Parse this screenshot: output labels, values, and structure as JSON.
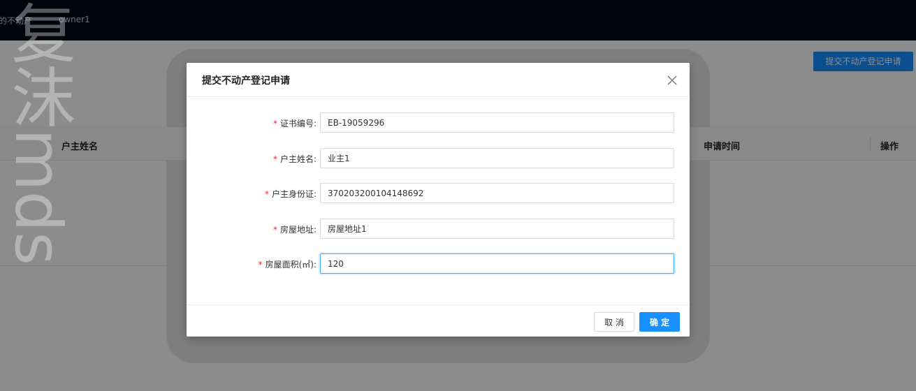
{
  "topbar": {
    "nav_item": "的不动产",
    "user": "owner1"
  },
  "toolbar": {
    "submit_label": "提交不动产登记申请"
  },
  "table": {
    "headers": [
      "户主姓名",
      "申请时间",
      "操作"
    ]
  },
  "watermark": {
    "text": "复沫mds"
  },
  "modal": {
    "title": "提交不动产登记申请",
    "close_icon": "close-icon",
    "fields": [
      {
        "label": "证书编号:",
        "value": "EB-19059296",
        "required": true
      },
      {
        "label": "户主姓名:",
        "value": "业主1",
        "required": true
      },
      {
        "label": "户主身份证:",
        "value": "370203200104148692",
        "required": true
      },
      {
        "label": "房屋地址:",
        "value": "房屋地址1",
        "required": true
      },
      {
        "label": "房屋面积(㎡):",
        "value": "120",
        "required": true
      }
    ],
    "required_mark": "*",
    "cancel_label": "取 消",
    "ok_label": "确 定"
  },
  "colors": {
    "primary": "#1890ff",
    "topbar": "#020817",
    "required": "#f5222d"
  }
}
